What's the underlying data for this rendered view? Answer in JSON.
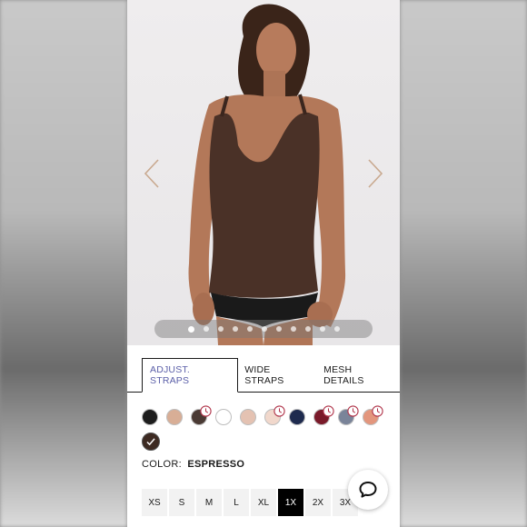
{
  "tabs": [
    {
      "label": "ADJUST. STRAPS",
      "active": true
    },
    {
      "label": "WIDE STRAPS",
      "active": false
    },
    {
      "label": "MESH DETAILS",
      "active": false
    }
  ],
  "gallery": {
    "image_count": 11,
    "active_index": 0
  },
  "swatches": [
    {
      "color": "#1d1d1d",
      "clock": false
    },
    {
      "color": "#d8ae96",
      "clock": false
    },
    {
      "color": "#4a3a34",
      "clock": true
    },
    {
      "color": "#ffffff",
      "clock": false
    },
    {
      "color": "#e4c2b2",
      "clock": false
    },
    {
      "color": "#f1d8cc",
      "clock": true
    },
    {
      "color": "#1e2a4e",
      "clock": false
    },
    {
      "color": "#7a1a2a",
      "clock": true
    },
    {
      "color": "#7a8499",
      "clock": true
    },
    {
      "color": "#e3967d",
      "clock": true
    },
    {
      "color": "#3d2a22",
      "clock": false,
      "selected": true
    }
  ],
  "color": {
    "label": "COLOR:",
    "value": "ESPRESSO"
  },
  "sizes": [
    {
      "label": "XS",
      "active": false
    },
    {
      "label": "S",
      "active": false
    },
    {
      "label": "M",
      "active": false
    },
    {
      "label": "L",
      "active": false
    },
    {
      "label": "XL",
      "active": false
    },
    {
      "label": "1X",
      "active": true
    },
    {
      "label": "2X",
      "active": false
    },
    {
      "label": "3X",
      "active": false
    }
  ],
  "colors": {
    "accent_tab": "#5b5fa8",
    "product": "#4a3127",
    "clock_badge": "#b0344a"
  }
}
